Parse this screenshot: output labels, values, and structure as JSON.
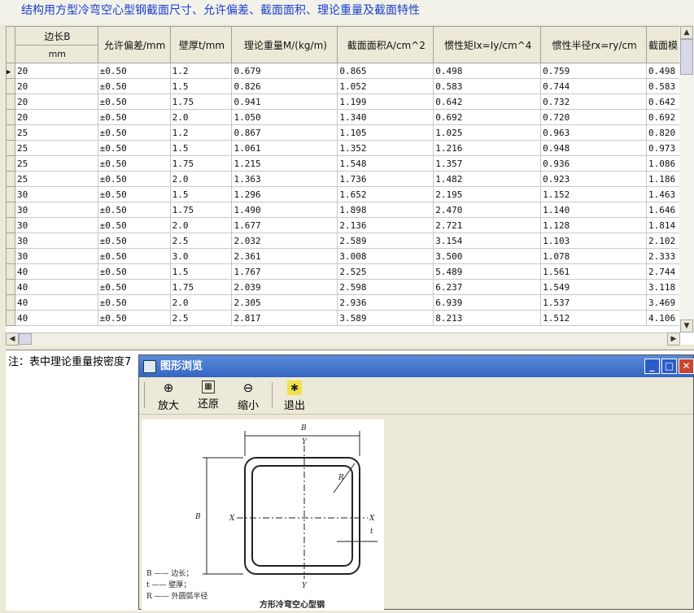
{
  "title": "结构用方型冷弯空心型钢截面尺寸、允许偏差、截面面积、理论重量及截面特性",
  "table": {
    "headers": [
      "边长B",
      "允许偏差/mm",
      "壁厚t/mm",
      "理论重量M/(kg/m)",
      "截面面积A/cm^2",
      "惯性矩Ix=Iy/cm^4",
      "惯性半径rx=ry/cm",
      "截面模"
    ],
    "subheader": "mm",
    "rows": [
      [
        "20",
        "±0.50",
        "1.2",
        "0.679",
        "0.865",
        "0.498",
        "0.759",
        "0.498"
      ],
      [
        "20",
        "±0.50",
        "1.5",
        "0.826",
        "1.052",
        "0.583",
        "0.744",
        "0.583"
      ],
      [
        "20",
        "±0.50",
        "1.75",
        "0.941",
        "1.199",
        "0.642",
        "0.732",
        "0.642"
      ],
      [
        "20",
        "±0.50",
        "2.0",
        "1.050",
        "1.340",
        "0.692",
        "0.720",
        "0.692"
      ],
      [
        "25",
        "±0.50",
        "1.2",
        "0.867",
        "1.105",
        "1.025",
        "0.963",
        "0.820"
      ],
      [
        "25",
        "±0.50",
        "1.5",
        "1.061",
        "1.352",
        "1.216",
        "0.948",
        "0.973"
      ],
      [
        "25",
        "±0.50",
        "1.75",
        "1.215",
        "1.548",
        "1.357",
        "0.936",
        "1.086"
      ],
      [
        "25",
        "±0.50",
        "2.0",
        "1.363",
        "1.736",
        "1.482",
        "0.923",
        "1.186"
      ],
      [
        "30",
        "±0.50",
        "1.5",
        "1.296",
        "1.652",
        "2.195",
        "1.152",
        "1.463"
      ],
      [
        "30",
        "±0.50",
        "1.75",
        "1.490",
        "1.898",
        "2.470",
        "1.140",
        "1.646"
      ],
      [
        "30",
        "±0.50",
        "2.0",
        "1.677",
        "2.136",
        "2.721",
        "1.128",
        "1.814"
      ],
      [
        "30",
        "±0.50",
        "2.5",
        "2.032",
        "2.589",
        "3.154",
        "1.103",
        "2.102"
      ],
      [
        "30",
        "±0.50",
        "3.0",
        "2.361",
        "3.008",
        "3.500",
        "1.078",
        "2.333"
      ],
      [
        "40",
        "±0.50",
        "1.5",
        "1.767",
        "2.525",
        "5.489",
        "1.561",
        "2.744"
      ],
      [
        "40",
        "±0.50",
        "1.75",
        "2.039",
        "2.598",
        "6.237",
        "1.549",
        "3.118"
      ],
      [
        "40",
        "±0.50",
        "2.0",
        "2.305",
        "2.936",
        "6.939",
        "1.537",
        "3.469"
      ],
      [
        "40",
        "±0.50",
        "2.5",
        "2.817",
        "3.589",
        "8.213",
        "1.512",
        "4.106"
      ]
    ]
  },
  "note": "注：表中理论重量按密度7",
  "viewer": {
    "title": "图形浏览",
    "buttons": {
      "zoom_in": "放大",
      "restore": "还原",
      "zoom_out": "缩小",
      "exit": "退出"
    },
    "window_controls": {
      "minimize": "_",
      "maximize": "□",
      "close": "✕"
    },
    "figure": {
      "dim_b": "B",
      "axis_y": "Y",
      "axis_x": "X",
      "radius": "R",
      "thickness": "t",
      "legend_b": "B —— 边长；",
      "legend_t": "t —— 壁厚；",
      "legend_r": "R —— 外圆弧半径",
      "caption": "方形冷弯空心型钢"
    }
  }
}
